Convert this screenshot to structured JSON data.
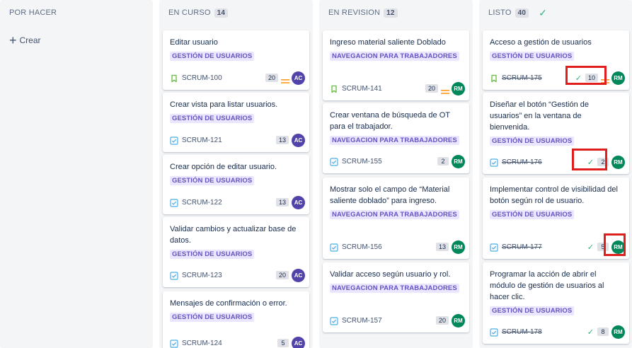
{
  "columns": {
    "todo": {
      "title": "POR HACER",
      "create_label": "Crear"
    },
    "in_progress": {
      "title": "EN CURSO",
      "count": "14"
    },
    "review": {
      "title": "EN REVISION",
      "count": "12"
    },
    "done": {
      "title": "LISTO",
      "count": "40"
    }
  },
  "in_progress_cards": [
    {
      "title": "Editar usuario",
      "epic": "GESTIÓN DE USUARIOS",
      "key": "SCRUM-100",
      "type": "story",
      "points": "20",
      "priority": "medium",
      "assignee": "AC"
    },
    {
      "title": "Crear vista para listar usuarios.",
      "epic": "GESTIÓN DE USUARIOS",
      "key": "SCRUM-121",
      "type": "task",
      "points": "13",
      "assignee": "AC"
    },
    {
      "title": "Crear opción de editar usuario.",
      "epic": "GESTIÓN DE USUARIOS",
      "key": "SCRUM-122",
      "type": "task",
      "points": "13",
      "assignee": "AC"
    },
    {
      "title": "Validar cambios y actualizar base de datos.",
      "epic": "GESTIÓN DE USUARIOS",
      "key": "SCRUM-123",
      "type": "task",
      "points": "20",
      "assignee": "AC"
    },
    {
      "title": "Mensajes de confirmación o error.",
      "epic": "GESTIÓN DE USUARIOS",
      "key": "SCRUM-124",
      "type": "task",
      "points": "5",
      "assignee": "AC"
    }
  ],
  "review_cards": [
    {
      "title": "Ingreso material saliente Doblado",
      "epic": "NAVEGACION PARA TRABAJADORES",
      "key": "SCRUM-141",
      "type": "story",
      "points": "20",
      "priority": "medium",
      "assignee": "RM"
    },
    {
      "title": "Crear ventana de búsqueda de OT para el trabajador.",
      "epic": "NAVEGACION PARA TRABAJADORES",
      "key": "SCRUM-155",
      "type": "task",
      "points": "2",
      "assignee": "RM"
    },
    {
      "title": "Mostrar solo el campo de “Material saliente doblado” para ingreso.",
      "epic": "NAVEGACION PARA TRABAJADORES",
      "key": "SCRUM-156",
      "type": "task",
      "points": "13",
      "assignee": "RM"
    },
    {
      "title": "Validar acceso según usuario y rol.",
      "epic": "NAVEGACION PARA TRABAJADORES",
      "key": "SCRUM-157",
      "type": "task",
      "points": "20",
      "assignee": "RM"
    }
  ],
  "done_cards": [
    {
      "title": "Acceso a gestión de usuarios",
      "epic": "GESTIÓN DE USUARIOS",
      "key": "SCRUM-175",
      "type": "story",
      "points": "10",
      "priority": "medium",
      "assignee": "RM"
    },
    {
      "title": "Diseñar el botón “Gestión de usuarios” en la ventana de bienvenida.",
      "epic": "GESTIÓN DE USUARIOS",
      "key": "SCRUM-176",
      "type": "task",
      "points": "2",
      "assignee": "RM"
    },
    {
      "title": "Implementar control de visibilidad del botón según rol de usuario.",
      "epic": "GESTIÓN DE USUARIOS",
      "key": "SCRUM-177",
      "type": "task",
      "points": "5",
      "assignee": "RM"
    },
    {
      "title": "Programar la acción de abrir el módulo de gestión de usuarios al hacer clic.",
      "epic": "GESTIÓN DE USUARIOS",
      "key": "SCRUM-178",
      "type": "task",
      "points": "8",
      "assignee": "RM"
    }
  ],
  "icons": {
    "story": "bookmark-icon",
    "task": "checkbox-icon",
    "priority_medium": "equals-icon",
    "done_check": "checkmark-icon"
  },
  "colors": {
    "epic_bg": "#eae6ff",
    "epic_text": "#6554c0",
    "avatar_ac": "#5243aa",
    "avatar_rm": "#00875a",
    "story_icon": "#63ba3c",
    "task_icon": "#4bade8",
    "priority_medium": "#ff991f",
    "highlight": "#e01e1e"
  }
}
